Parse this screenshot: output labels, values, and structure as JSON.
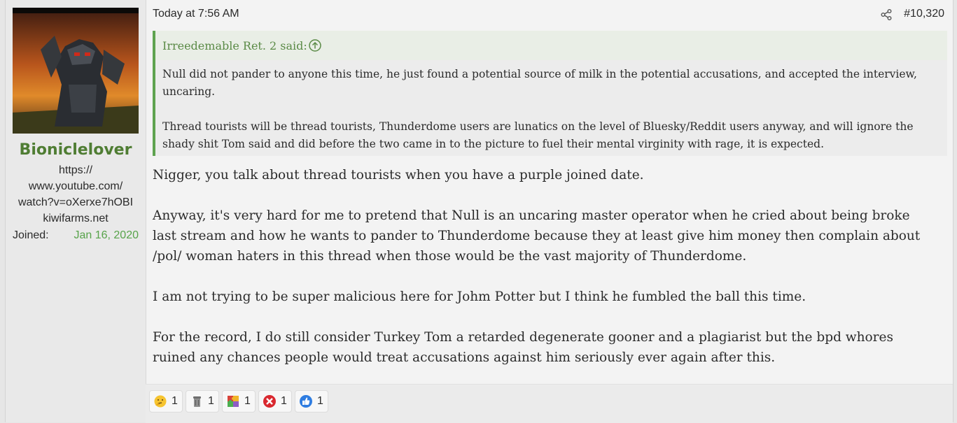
{
  "user": {
    "name": "Bioniclelover",
    "title_lines": [
      "https://",
      "www.youtube.com/",
      "watch?v=oXerxe7hOBI",
      "kiwifarms.net"
    ],
    "joined_label": "Joined:",
    "joined_value": "Jan 16, 2020"
  },
  "post": {
    "date": "Today at 7:56 AM",
    "number": "#10,320",
    "quote": {
      "author": "Irreedemable Ret. 2 said:",
      "paragraphs": [
        "Null did not pander to anyone this time, he just found a potential source of milk in the potential accusations, and accepted the interview, uncaring.",
        "Thread tourists will be thread tourists, Thunderdome users are lunatics on the level of Bluesky/Reddit users anyway, and will ignore the shady shit Tom said and did before the two came in to the picture to fuel their mental virginity with rage, it is expected."
      ]
    },
    "paragraphs": [
      "Nigger, you talk about thread tourists when you have a purple joined date.",
      "Anyway, it's very hard for me to pretend that Null is an uncaring master operator when he cried about being broke last stream and how he wants to pander to Thunderdome because they at least give him money then complain about /pol/ woman haters in this thread when those would be the vast majority of Thunderdome.",
      "I am not trying to be super malicious here for Johm Potter but I think he fumbled the ball this time.",
      "For the record, I do still consider Turkey Tom a retarded degenerate gooner and a plagiarist but the bpd whores ruined any chances people would treat accusations against him seriously ever again after this."
    ]
  },
  "reactions": [
    {
      "icon": "thinking-emoji-icon",
      "count": "1"
    },
    {
      "icon": "trash-can-icon",
      "count": "1"
    },
    {
      "icon": "puzzle-piece-icon",
      "count": "1"
    },
    {
      "icon": "red-x-icon",
      "count": "1"
    },
    {
      "icon": "thumbs-up-icon",
      "count": "1"
    }
  ],
  "colors": {
    "accent_green": "#57a34a",
    "username_green": "#4f7d33",
    "quote_bar": "#5ea34f"
  }
}
